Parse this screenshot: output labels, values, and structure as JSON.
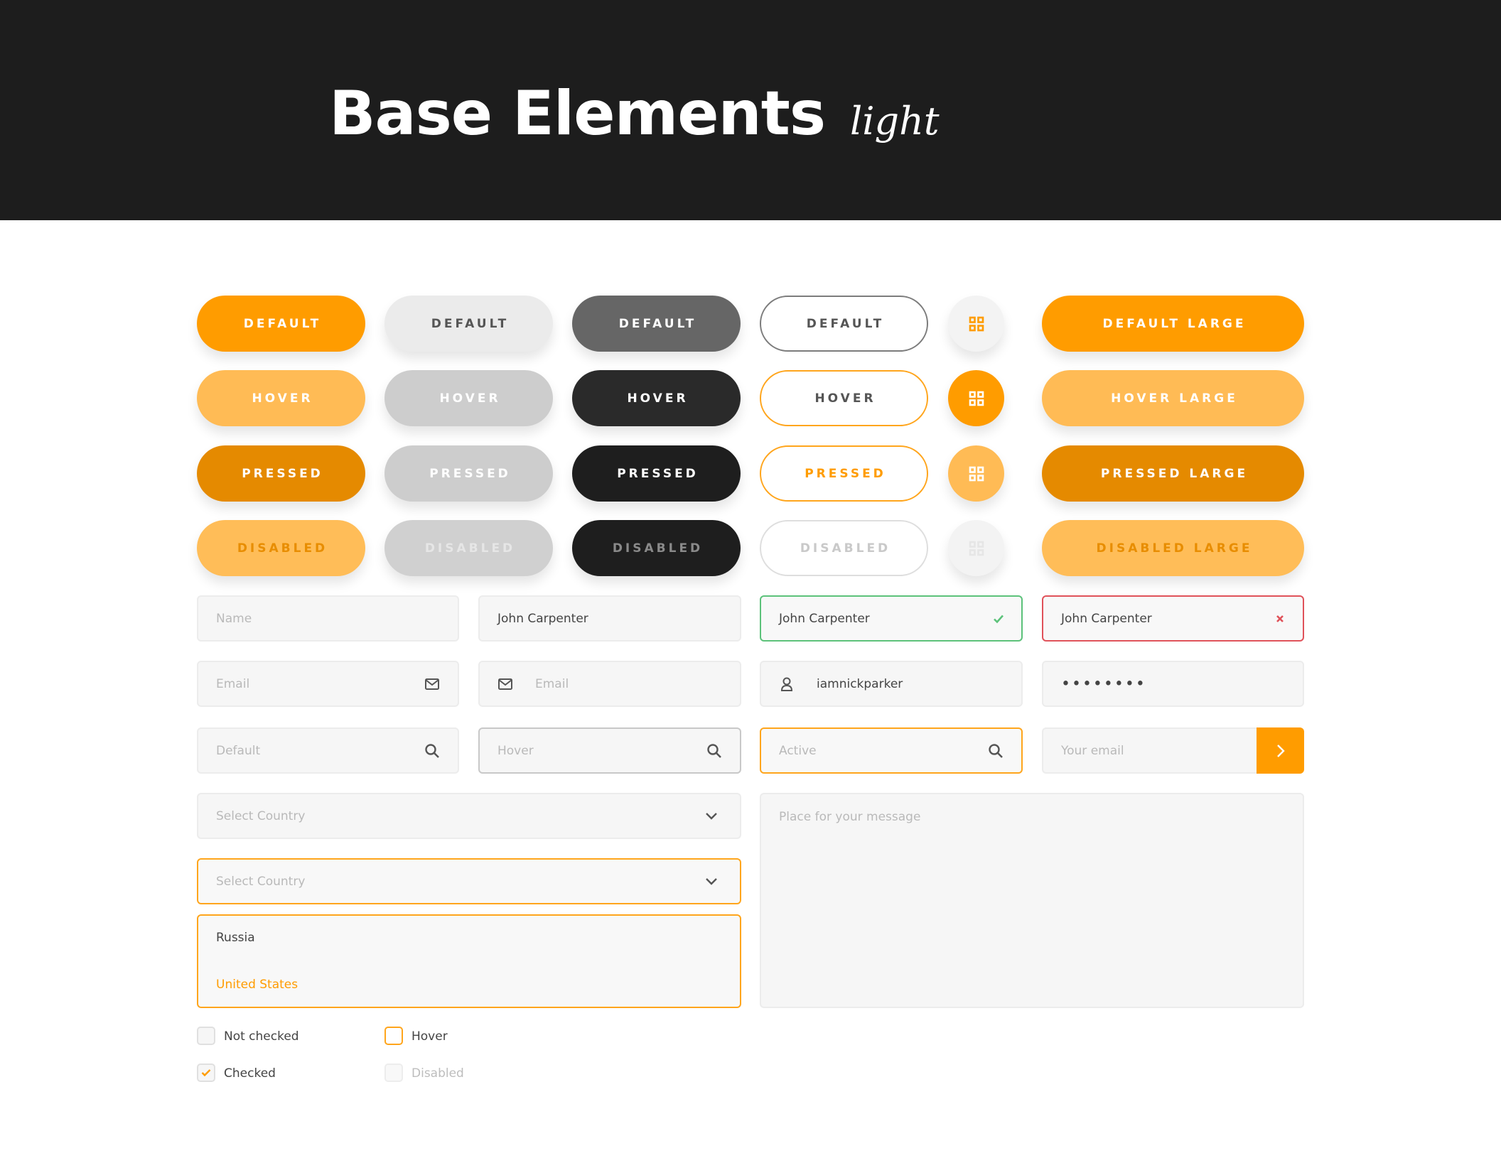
{
  "header": {
    "title": "Base Elements",
    "subtitle": "light"
  },
  "colors": {
    "accent": "#ff9c00",
    "dark": "#1d1d1d",
    "success": "#5cc27a",
    "error": "#e0525a"
  },
  "buttons": {
    "orange": [
      "DEFAULT",
      "HOVER",
      "PRESSED",
      "DISABLED"
    ],
    "gray": [
      "DEFAULT",
      "HOVER",
      "PRESSED",
      "DISABLED"
    ],
    "dark": [
      "DEFAULT",
      "HOVER",
      "PRESSED",
      "DISABLED"
    ],
    "outline": [
      "DEFAULT",
      "HOVER",
      "PRESSED",
      "DISABLED"
    ],
    "large": [
      "DEFAULT LARGE",
      "HOVER LARGE",
      "PRESSED LARGE",
      "DISABLED LARGE"
    ],
    "icon_buttons_icon": "grid-icon"
  },
  "inputs": {
    "name_placeholder": "Name",
    "name_value": "John Carpenter",
    "valid_value": "John Carpenter",
    "invalid_value": "John Carpenter",
    "email_placeholder": "Email",
    "email_left_placeholder": "Email",
    "username_value": "iamnickparker",
    "password_value": "••••••••",
    "search_default_placeholder": "Default",
    "search_hover_placeholder": "Hover",
    "search_active_placeholder": "Active",
    "subscribe_placeholder": "Your email"
  },
  "selects": {
    "default_placeholder": "Select Country",
    "open_placeholder": "Select Country",
    "options": [
      "Russia",
      "United States"
    ]
  },
  "textarea": {
    "placeholder": "Place for your message"
  },
  "checkboxes": [
    {
      "label": "Not checked",
      "state": "unchecked"
    },
    {
      "label": "Hover",
      "state": "hover"
    },
    {
      "label": "Checked",
      "state": "checked"
    },
    {
      "label": "Disabled",
      "state": "disabled"
    }
  ]
}
